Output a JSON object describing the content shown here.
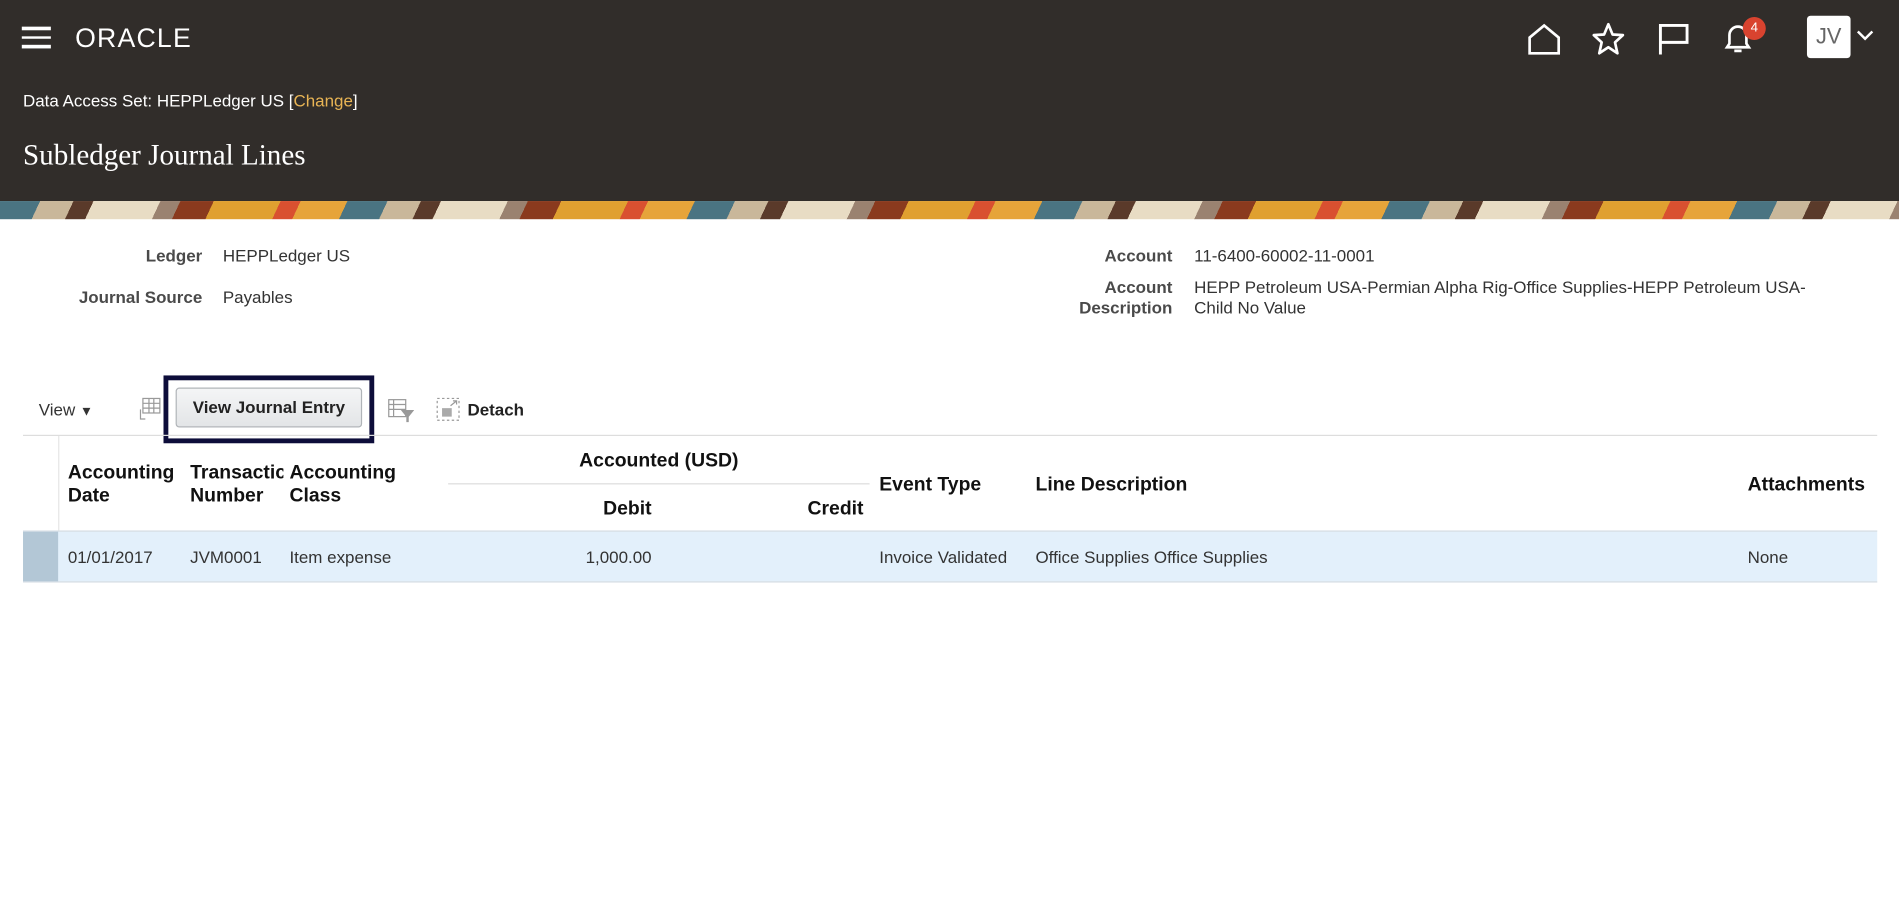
{
  "header": {
    "logo": "ORACLE",
    "notification_count": "4",
    "user_initials": "JV",
    "data_access_label": "Data Access Set:",
    "data_access_value": "HEPPLedger US",
    "change_link": "Change",
    "page_title": "Subledger Journal Lines"
  },
  "details": {
    "ledger_label": "Ledger",
    "ledger_value": "HEPPLedger US",
    "source_label": "Journal Source",
    "source_value": "Payables",
    "account_label": "Account",
    "account_value": "11-6400-60002-11-0001",
    "desc_label_1": "Account",
    "desc_label_2": "Description",
    "desc_value_1": "HEPP Petroleum USA-Permian Alpha Rig-Office Supplies-HEPP Petroleum USA-",
    "desc_value_2": "Child No Value"
  },
  "toolbar": {
    "view": "View",
    "view_journal_entry": "View Journal Entry",
    "detach": "Detach"
  },
  "table": {
    "headers": {
      "acc_date_1": "Accounting",
      "acc_date_2": "Date",
      "trx_1": "Transactic",
      "trx_2": "Number",
      "class_1": "Accounting",
      "class_2": "Class",
      "accounted": "Accounted (USD)",
      "debit": "Debit",
      "credit": "Credit",
      "event": "Event Type",
      "line_desc": "Line Description",
      "attach": "Attachments"
    },
    "rows": [
      {
        "date": "01/01/2017",
        "number": "JVM0001",
        "class": "Item expense",
        "debit": "1,000.00",
        "credit": "",
        "event": "Invoice Validated",
        "description": "Office Supplies Office Supplies",
        "attachments": "None"
      }
    ]
  },
  "colors": {
    "header_bg": "#312d2a",
    "link": "#e8b454",
    "badge": "#d9432f",
    "selected_row": "#e3f0fb",
    "highlight_border": "#0d0d3a"
  }
}
